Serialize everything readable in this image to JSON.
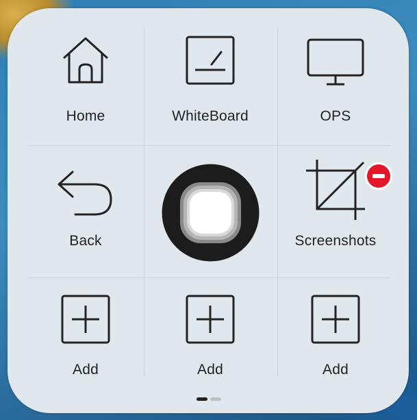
{
  "menu": {
    "items": [
      {
        "label": "Home",
        "icon": "home-icon"
      },
      {
        "label": "WhiteBoard",
        "icon": "whiteboard-icon"
      },
      {
        "label": "OPS",
        "icon": "monitor-icon"
      },
      {
        "label": "Back",
        "icon": "back-arrow-icon"
      },
      {
        "label": "Screenshots",
        "icon": "crop-icon"
      },
      {
        "label": "Add",
        "icon": "add-icon"
      },
      {
        "label": "Add",
        "icon": "add-icon"
      },
      {
        "label": "Add",
        "icon": "add-icon"
      }
    ],
    "remove_badge_icon": "remove-icon",
    "center_button_icon": "home-button-icon"
  },
  "pager": {
    "pages": 2,
    "active": 1
  },
  "colors": {
    "panel": "#e0e8ee",
    "icon_stroke": "#222222",
    "badge": "#e4162a"
  }
}
